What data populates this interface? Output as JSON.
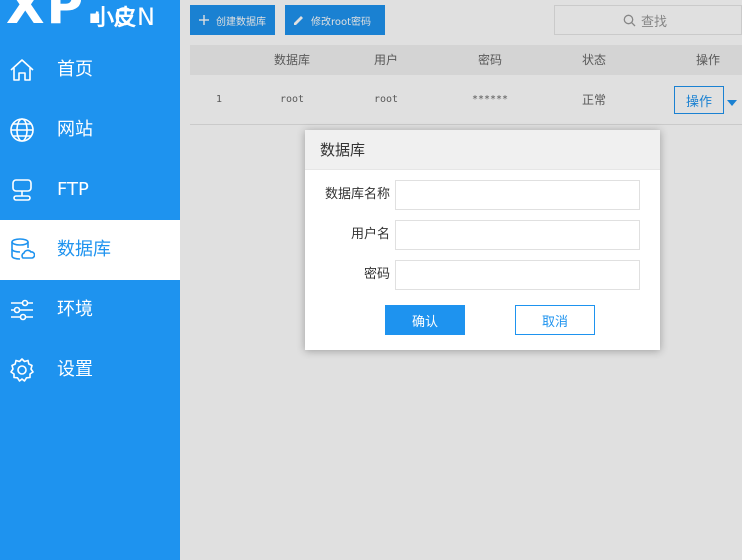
{
  "logo": {
    "main": "XP",
    "dot": ".",
    "sub": "CN",
    "cjk": "小皮"
  },
  "sidebar": {
    "items": [
      {
        "label": "首页",
        "icon": "home-icon"
      },
      {
        "label": "网站",
        "icon": "globe-icon"
      },
      {
        "label": "FTP",
        "icon": "server-icon"
      },
      {
        "label": "数据库",
        "icon": "database-icon",
        "active": true
      },
      {
        "label": "环境",
        "icon": "sliders-icon"
      },
      {
        "label": "设置",
        "icon": "gear-icon"
      }
    ]
  },
  "toolbar": {
    "create_label": "创建数据库",
    "change_pw_label": "修改root密码"
  },
  "search": {
    "placeholder": "查找"
  },
  "table": {
    "headers": [
      "数据库",
      "用户",
      "密码",
      "状态",
      "操作"
    ],
    "rows": [
      {
        "index": "1",
        "database": "root",
        "user": "root",
        "password": "******",
        "status": "正常",
        "action": "操作"
      }
    ]
  },
  "modal": {
    "title": "数据库",
    "fields": [
      {
        "label": "数据库名称",
        "value": "",
        "placeholder": ""
      },
      {
        "label": "用户名",
        "value": "",
        "placeholder": ""
      },
      {
        "label": "密码",
        "value": "",
        "placeholder": ""
      }
    ],
    "confirm_label": "确认",
    "cancel_label": "取消"
  },
  "colors": {
    "accent": "#1e93ef",
    "sidebar_bg": "#1e93ef",
    "overlay": "rgba(0,0,0,0.12)"
  }
}
